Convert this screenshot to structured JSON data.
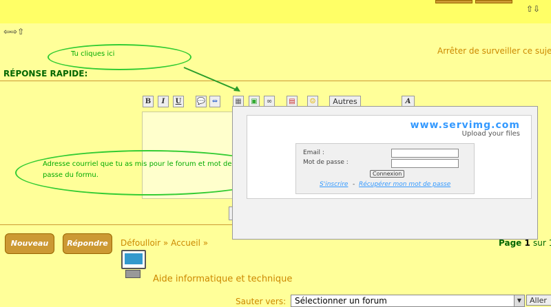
{
  "rapid_reply": {
    "title": "RÉPONSE RAPIDE:",
    "stop_watching": "Arrêter de surveiller ce suje",
    "annotation_click": "Tu cliques ici",
    "annotation_email": "Adresse courriel que tu as mis pour le forum et mot de passe du formu.",
    "toolbar": {
      "bold": "B",
      "italic": "I",
      "underline": "U",
      "more": "Autres",
      "font_size": "A"
    }
  },
  "servimg_popup": {
    "brand": "www.servimg.com",
    "tagline": "Upload your files",
    "email_label": "Email :",
    "password_label": "Mot de passe :",
    "connect_button": "Connexion",
    "register_link": "S'inscrire",
    "separator": "-",
    "recover_link": "Récupérer mon mot de passe"
  },
  "bottom": {
    "new_button": "Nouveau",
    "reply_button": "Répondre",
    "breadcrumb_forum": "Défoulloir",
    "breadcrumb_sep": "»",
    "breadcrumb_home": "Accueil",
    "breadcrumb_end": "»",
    "page_label": "Page",
    "page_current": "1",
    "page_of": "sur 1",
    "category_title": "Aide informatique et technique",
    "jump_label": "Sauter vers:",
    "jump_select": "Sélectionner un forum",
    "go_button": "Aller"
  },
  "colors": {
    "background": "#ffff99",
    "accent": "#cc9933",
    "annotation": "#33cc33",
    "brand_blue": "#3399ff"
  }
}
